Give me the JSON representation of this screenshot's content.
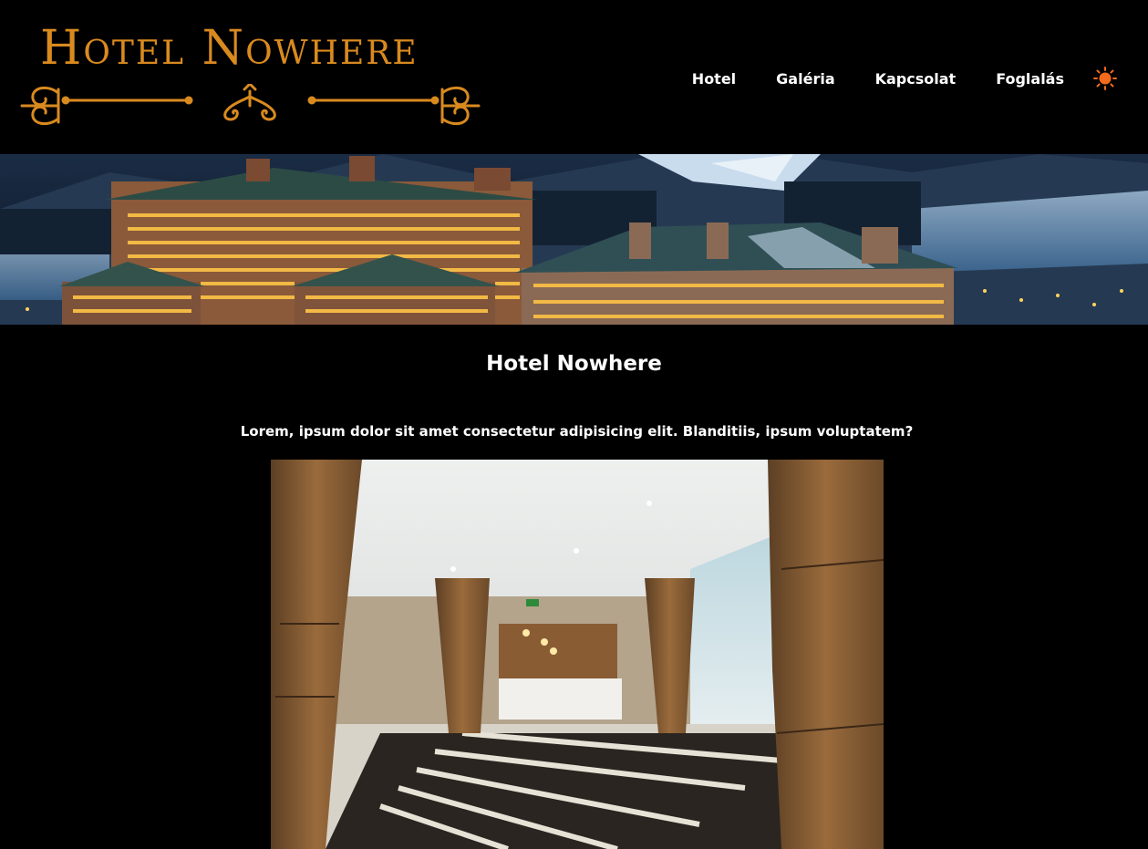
{
  "header": {
    "logo_text": "Hotel Nowhere",
    "nav": [
      {
        "label": "Hotel"
      },
      {
        "label": "Galéria"
      },
      {
        "label": "Kapcsolat"
      },
      {
        "label": "Foglalás"
      }
    ],
    "theme_toggle_icon": "sun-icon"
  },
  "main": {
    "title": "Hotel Nowhere",
    "intro": "Lorem, ipsum dolor sit amet consectetur adipisicing elit. Blanditiis, ipsum voluptatem?"
  },
  "colors": {
    "background": "#000000",
    "accent": "#d98a1f",
    "text": "#ffffff",
    "sun": "#f26b1d"
  }
}
